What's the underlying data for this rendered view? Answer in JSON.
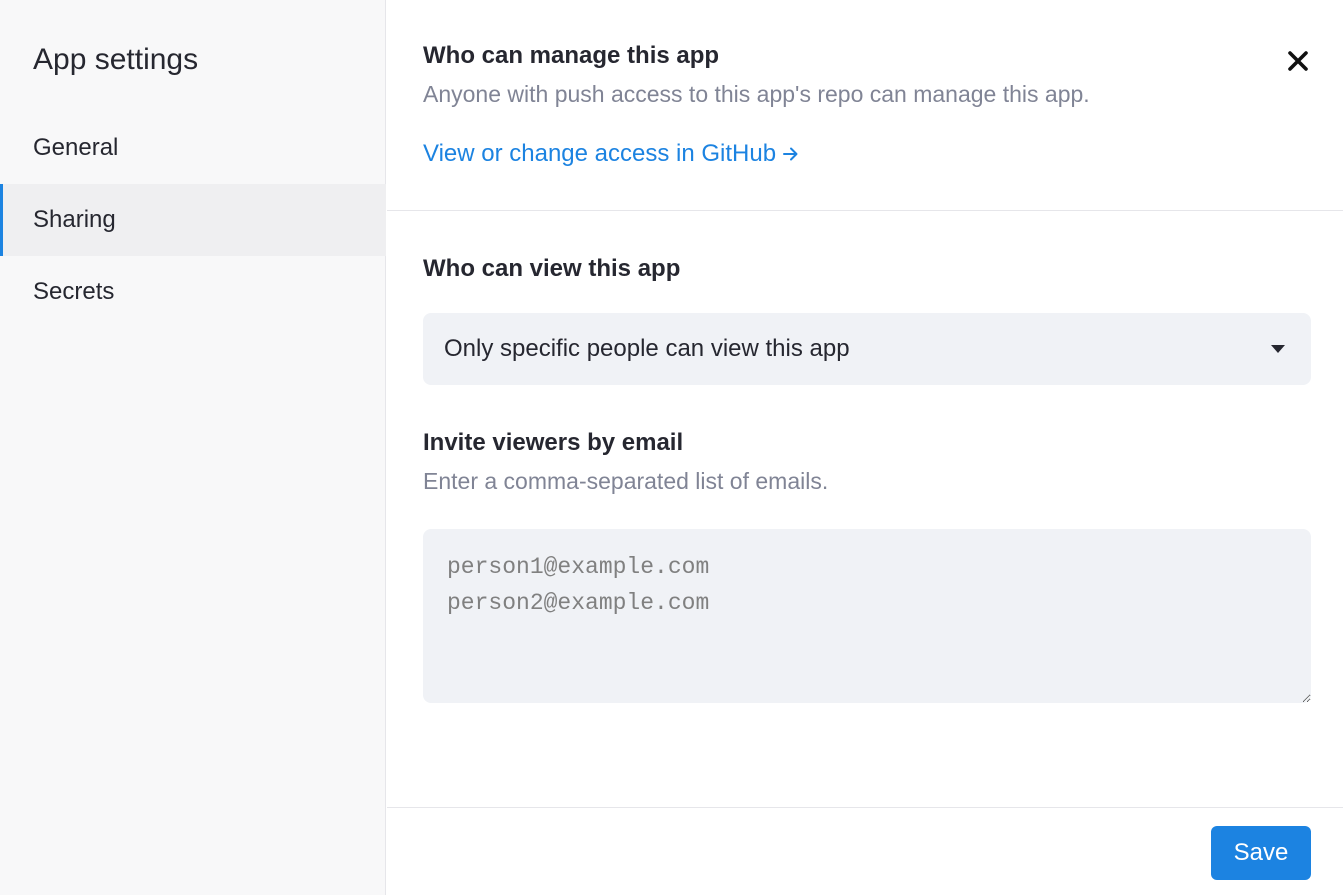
{
  "sidebar": {
    "title": "App settings",
    "items": [
      {
        "label": "General",
        "active": false
      },
      {
        "label": "Sharing",
        "active": true
      },
      {
        "label": "Secrets",
        "active": false
      }
    ]
  },
  "manage": {
    "heading": "Who can manage this app",
    "description": "Anyone with push access to this app's repo can manage this app.",
    "link_label": "View or change access in GitHub",
    "link_icon": "arrow-right-icon",
    "close_icon": "close-icon"
  },
  "view": {
    "heading": "Who can view this app",
    "select_value": "Only specific people can view this app",
    "select_icon": "caret-down-icon"
  },
  "invite": {
    "heading": "Invite viewers by email",
    "description": "Enter a comma-separated list of emails.",
    "placeholder": "person1@example.com\nperson2@example.com",
    "value": ""
  },
  "footer": {
    "save_label": "Save"
  },
  "colors": {
    "accent": "#1c83e1",
    "sidebar_bg": "#f8f8f9",
    "input_bg": "#f0f2f6",
    "muted_text": "#808495"
  }
}
